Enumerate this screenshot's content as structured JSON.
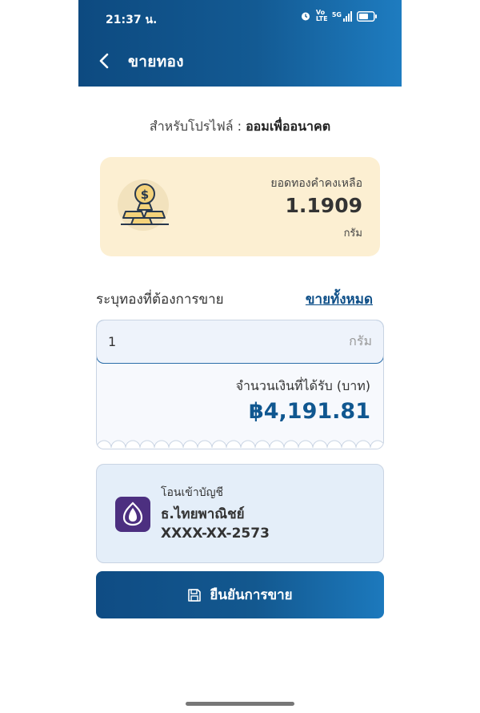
{
  "status_bar": {
    "time": "21:37 น.",
    "network": "Vo LTE",
    "signal": "5G"
  },
  "header": {
    "title": "ขายทอง"
  },
  "profile": {
    "prefix": "สำหรับโปรไฟล์ :",
    "name": "ออมเพื่ออนาคต"
  },
  "balance": {
    "label": "ยอดทองคำคงเหลือ",
    "value": "1.1909",
    "unit": "กรัม"
  },
  "sell": {
    "label": "ระบุทองที่ต้องการขาย",
    "sell_all_label": "ขายทั้งหมด",
    "input_value": "1",
    "input_unit": "กรัม",
    "receive_label": "จำนวนเงินที่ได้รับ (บาท)",
    "receive_value": "฿4,191.81"
  },
  "bank": {
    "transfer_label": "โอนเข้าบัญชี",
    "bank_name": "ธ.ไทยพาณิชย์",
    "account_number": "XXXX-XX-2573"
  },
  "confirm": {
    "label": "ยืนยันการขาย"
  },
  "colors": {
    "primary": "#0f4c84",
    "accent": "#1c79bd",
    "gold_card": "#fcefd2",
    "bank_purple": "#4c2f80"
  }
}
